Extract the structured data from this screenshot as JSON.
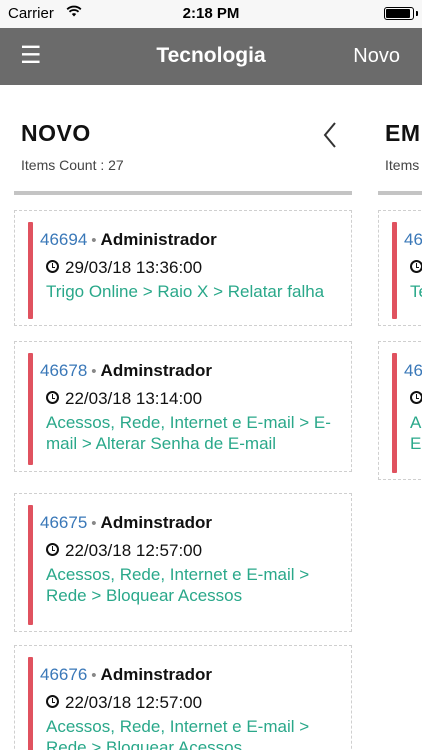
{
  "status_bar": {
    "carrier": "Carrier",
    "time": "2:18 PM"
  },
  "navbar": {
    "menu_icon": "☰",
    "title": "Tecnologia",
    "new_label": "Novo"
  },
  "columns": [
    {
      "title": "NOVO",
      "count_text": "Items Count : 27",
      "cards": [
        {
          "id": "46694",
          "user": "Administrador",
          "date": "29/03/18 13:36:00",
          "path": "Trigo Online > Raio X > Relatar falha"
        },
        {
          "id": "46678",
          "user": "Adminstrador",
          "date": "22/03/18 13:14:00",
          "path": "Acessos, Rede, Internet e E-mail > E-mail > Alterar Senha de E-mail"
        },
        {
          "id": "46675",
          "user": "Adminstrador",
          "date": "22/03/18 12:57:00",
          "path": "Acessos, Rede, Internet e E-mail > Rede > Bloquear Acessos"
        },
        {
          "id": "46676",
          "user": "Adminstrador",
          "date": "22/03/18 12:57:00",
          "path": "Acessos, Rede, Internet e E-mail > Rede > Bloquear Acessos"
        }
      ]
    },
    {
      "title": "EM",
      "count_text": "Items",
      "cards": [
        {
          "id": "46",
          "path": "Te"
        },
        {
          "id": "46",
          "path": "A E"
        }
      ]
    }
  ],
  "colors": {
    "accent_bar": "#e0525f",
    "id_link": "#3a78b8",
    "path_text": "#2aa88a",
    "navbar": "#6b6b6b"
  }
}
